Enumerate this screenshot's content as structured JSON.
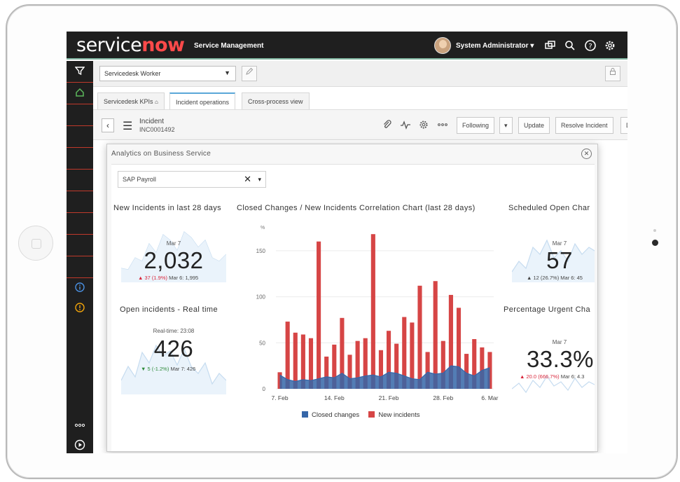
{
  "app": {
    "logo_service": "service",
    "logo_now": "now",
    "product": "Service Management",
    "user": "System Administrator",
    "user_caret": "▾"
  },
  "ribbon": {
    "selected_workspace": "Servicedesk Worker"
  },
  "tabs": [
    {
      "label": "Servicedesk KPIs"
    },
    {
      "label": "Incident operations"
    },
    {
      "label": "Cross-process view"
    }
  ],
  "record": {
    "type": "Incident",
    "number": "INC0001492",
    "buttons": {
      "following": "Following",
      "update": "Update",
      "resolve": "Resolve Incident",
      "delete": "Delete"
    }
  },
  "modal": {
    "title": "Analytics on Business Service",
    "filter_value": "SAP Payroll",
    "filter_clear": "✕",
    "filter_caret": "▾"
  },
  "widgets": {
    "new_incidents": {
      "title": "New Incidents in last 28 days",
      "date": "Mar 7",
      "value": "2,032",
      "change": "▲ 37 (1.9%)",
      "prev": "Mar 6: 1,995"
    },
    "open_incidents": {
      "title": "Open incidents - Real time",
      "date": "Real-time: 23:08",
      "value": "426",
      "change": "▼ 5 (-1.2%)",
      "prev": "Mar 7: 426"
    },
    "scheduled_open": {
      "title": "Scheduled Open Char",
      "date": "Mar 7",
      "value": "57",
      "change": "▲ 12 (26.7%)",
      "prev": "Mar 6: 45"
    },
    "percentage_urgent": {
      "title": "Percentage Urgent Cha",
      "date": "Mar 7",
      "value": "33.3%",
      "change": "▲ 20.0 (666.7%)",
      "prev": "Mar 6: 4.3"
    }
  },
  "colors": {
    "closed": "#3566a8",
    "new": "#d64545",
    "accent": "#5aa7d8",
    "brand_red": "#ff4a4a"
  },
  "chart_data": {
    "type": "bar",
    "title": "Closed Changes / New Incidents Correlation Chart (last 28 days)",
    "ylabel": "",
    "y_axis_unit_marker": "%",
    "ylim": [
      0,
      175
    ],
    "yticks": [
      0,
      50,
      100,
      150
    ],
    "xtick_labels": [
      "7. Feb",
      "14. Feb",
      "21. Feb",
      "28. Feb",
      "6. Mar"
    ],
    "categories": [
      "7. Feb",
      "8. Feb",
      "9. Feb",
      "10. Feb",
      "11. Feb",
      "12. Feb",
      "13. Feb",
      "14. Feb",
      "15. Feb",
      "16. Feb",
      "17. Feb",
      "18. Feb",
      "19. Feb",
      "20. Feb",
      "21. Feb",
      "22. Feb",
      "23. Feb",
      "24. Feb",
      "25. Feb",
      "26. Feb",
      "27. Feb",
      "28. Feb",
      "1. Mar",
      "2. Mar",
      "3. Mar",
      "4. Mar",
      "5. Mar",
      "6. Mar"
    ],
    "series": [
      {
        "name": "Closed changes",
        "type": "area",
        "values": [
          15,
          10,
          8,
          10,
          9,
          11,
          13,
          12,
          17,
          11,
          12,
          14,
          15,
          13,
          18,
          17,
          14,
          11,
          10,
          18,
          16,
          17,
          25,
          24,
          17,
          14,
          20,
          23
        ]
      },
      {
        "name": "New incidents",
        "type": "bar",
        "values": [
          18,
          73,
          61,
          59,
          55,
          160,
          35,
          48,
          77,
          37,
          52,
          55,
          168,
          42,
          63,
          49,
          78,
          72,
          112,
          40,
          117,
          52,
          102,
          88,
          38,
          54,
          45,
          40
        ]
      }
    ],
    "legend": [
      {
        "label": "Closed changes"
      },
      {
        "label": "New incidents"
      }
    ],
    "legend_position": "bottom"
  }
}
